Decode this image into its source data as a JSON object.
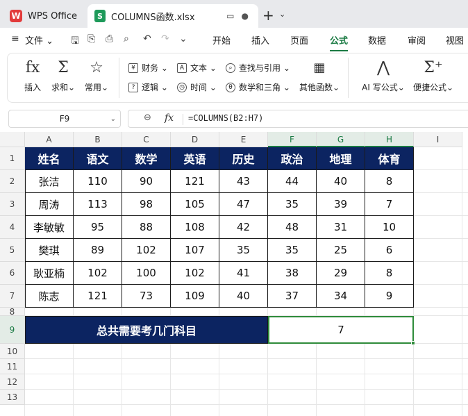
{
  "window": {
    "app_tab": "WPS Office",
    "file_tab": "COLUMNS函数.xlsx",
    "new_tab_icon": "plus-icon"
  },
  "menubar": {
    "file_label": "文件",
    "items": [
      "开始",
      "插入",
      "页面",
      "公式",
      "数据",
      "审阅",
      "视图"
    ],
    "active": "公式"
  },
  "ribbon": {
    "big_buttons": [
      {
        "label": "插入",
        "icon": "fx-icon"
      },
      {
        "label": "求和",
        "icon": "sigma-icon"
      },
      {
        "label": "常用",
        "icon": "star-icon"
      }
    ],
    "small_buttons": {
      "finance": "财务",
      "logic": "逻辑",
      "text": "文本",
      "time": "时间",
      "lookup": "查找与引用",
      "math": "数学和三角"
    },
    "other_functions": "其他函数",
    "ai_formula": "AI 写公式",
    "quick_formula": "便捷公式"
  },
  "formula_bar": {
    "cell_ref": "F9",
    "formula": "=COLUMNS(B2:H7)"
  },
  "grid": {
    "columns": [
      "A",
      "B",
      "C",
      "D",
      "E",
      "F",
      "G",
      "H",
      "I"
    ],
    "selected_columns": [
      "F",
      "G",
      "H"
    ],
    "rows": [
      "1",
      "2",
      "3",
      "4",
      "5",
      "6",
      "7",
      "8",
      "9",
      "10",
      "11",
      "12",
      "13"
    ],
    "selected_row": "9"
  },
  "table": {
    "headers": [
      "姓名",
      "语文",
      "数学",
      "英语",
      "历史",
      "政治",
      "地理",
      "体育"
    ],
    "rows": [
      [
        "张洁",
        "110",
        "90",
        "121",
        "43",
        "44",
        "40",
        "8"
      ],
      [
        "周涛",
        "113",
        "98",
        "105",
        "47",
        "35",
        "39",
        "7"
      ],
      [
        "李敏敏",
        "95",
        "88",
        "108",
        "42",
        "48",
        "31",
        "10"
      ],
      [
        "樊琪",
        "89",
        "102",
        "107",
        "35",
        "35",
        "25",
        "6"
      ],
      [
        "耿亚楠",
        "102",
        "100",
        "102",
        "41",
        "38",
        "29",
        "8"
      ],
      [
        "陈志",
        "121",
        "73",
        "109",
        "40",
        "37",
        "34",
        "9"
      ]
    ]
  },
  "summary": {
    "label": "总共需要考几门科目",
    "value": "7"
  },
  "colors": {
    "header_fill": "#0c2461",
    "accent_green": "#1a7a43",
    "selection_border": "#2e8b3a"
  }
}
